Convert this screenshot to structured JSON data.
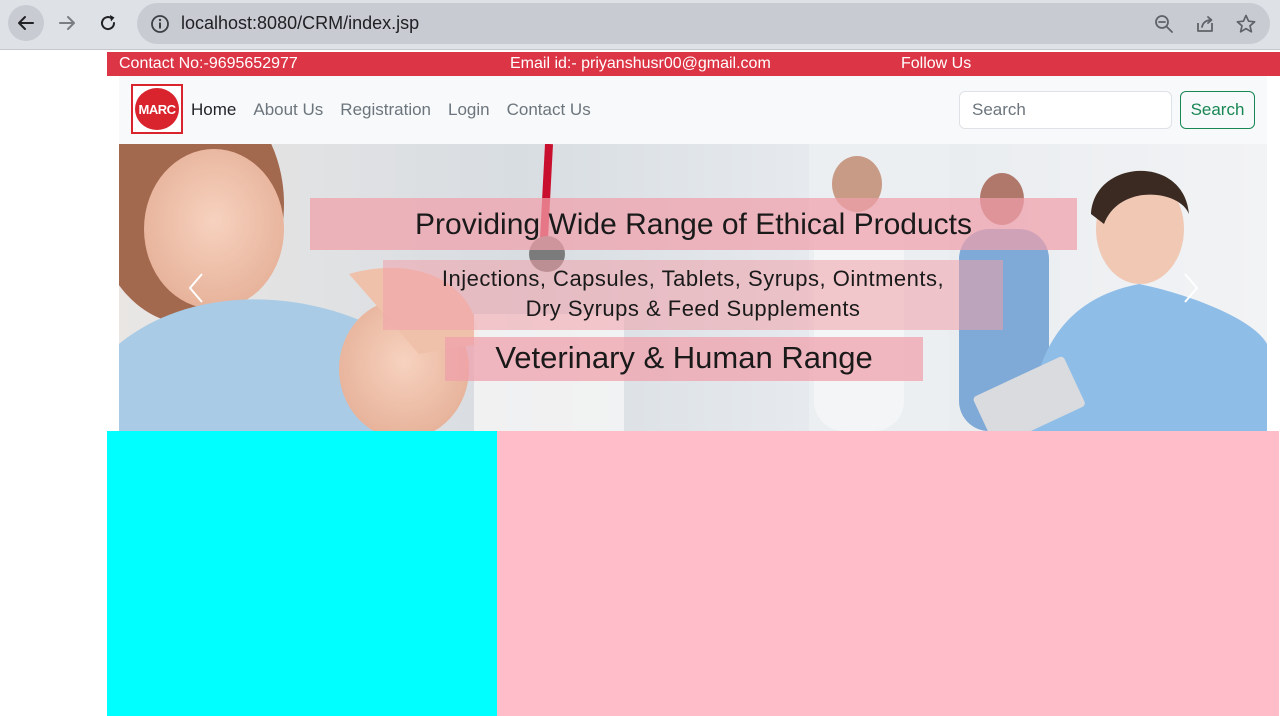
{
  "browser": {
    "url": "localhost:8080/CRM/index.jsp",
    "icons": [
      "back-arrow-icon",
      "forward-arrow-icon",
      "reload-icon",
      "info-icon",
      "zoom-icon",
      "share-icon",
      "star-icon"
    ]
  },
  "topbar": {
    "contact": "Contact No:-9695652977",
    "email": "Email id:- priyanshusr00@gmail.com",
    "follow": "Follow Us"
  },
  "navbar": {
    "logo_text": "MARC",
    "links": [
      "Home",
      "About Us",
      "Registration",
      "Login",
      "Contact Us"
    ],
    "search_placeholder": "Search",
    "search_button": "Search"
  },
  "banner": {
    "headline": "Providing Wide Range of Ethical Products",
    "products_line1": "Injections,  Capsules,  Tablets,  Syrups,  Ointments,",
    "products_line2": "Dry  Syrups  &  Feed  Supplements",
    "range": "Veterinary & Human Range"
  },
  "colors": {
    "topbar": "#dc3545",
    "left_block": "#00ffff",
    "right_block": "#ffbdca",
    "search_button": "#198754"
  }
}
